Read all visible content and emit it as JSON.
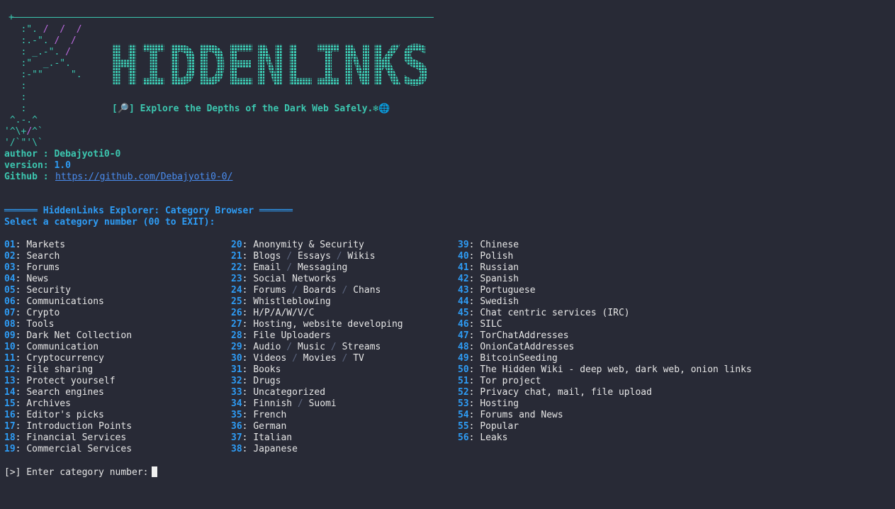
{
  "logo": {
    "text": "HIDDENLINKS"
  },
  "tagline": "[🔎] Explore the Depths of the Dark Web Safely.❄🌐",
  "meta": {
    "author_label": "author : ",
    "author": "Debajyoti0-0",
    "version_label": "version: ",
    "version": "1.0",
    "github_label": "Github : ",
    "github": "https://github.com/Debajyoti0-0/"
  },
  "header": {
    "rule": "══════",
    "title": "HiddenLinks Explorer: Category Browser",
    "prompt": "Select a category number (00 to EXIT):"
  },
  "categories": [
    [
      "01",
      "Markets"
    ],
    [
      "02",
      "Search"
    ],
    [
      "03",
      "Forums"
    ],
    [
      "04",
      "News"
    ],
    [
      "05",
      "Security"
    ],
    [
      "06",
      "Communications"
    ],
    [
      "07",
      "Crypto"
    ],
    [
      "08",
      "Tools"
    ],
    [
      "09",
      "Dark Net Collection"
    ],
    [
      "10",
      "Communication"
    ],
    [
      "11",
      "Cryptocurrency"
    ],
    [
      "12",
      "File sharing"
    ],
    [
      "13",
      "Protect yourself"
    ],
    [
      "14",
      "Search engines"
    ],
    [
      "15",
      "Archives"
    ],
    [
      "16",
      "Editor's picks"
    ],
    [
      "17",
      "Introduction Points"
    ],
    [
      "18",
      "Financial Services"
    ],
    [
      "19",
      "Commercial Services"
    ],
    [
      "20",
      "Anonymity & Security"
    ],
    [
      "21",
      "Blogs / Essays / Wikis"
    ],
    [
      "22",
      "Email / Messaging"
    ],
    [
      "23",
      "Social Networks"
    ],
    [
      "24",
      "Forums / Boards / Chans"
    ],
    [
      "25",
      "Whistleblowing"
    ],
    [
      "26",
      "H/P/A/W/V/C"
    ],
    [
      "27",
      "Hosting, website developing"
    ],
    [
      "28",
      "File Uploaders"
    ],
    [
      "29",
      "Audio / Music / Streams"
    ],
    [
      "30",
      "Videos / Movies / TV"
    ],
    [
      "31",
      "Books"
    ],
    [
      "32",
      "Drugs"
    ],
    [
      "33",
      "Uncategorized"
    ],
    [
      "34",
      "Finnish / Suomi"
    ],
    [
      "35",
      "French"
    ],
    [
      "36",
      "German"
    ],
    [
      "37",
      "Italian"
    ],
    [
      "38",
      "Japanese"
    ],
    [
      "39",
      "Chinese"
    ],
    [
      "40",
      "Polish"
    ],
    [
      "41",
      "Russian"
    ],
    [
      "42",
      "Spanish"
    ],
    [
      "43",
      "Portuguese"
    ],
    [
      "44",
      "Swedish"
    ],
    [
      "45",
      "Chat centric services (IRC)"
    ],
    [
      "46",
      "SILC"
    ],
    [
      "47",
      "TorChatAddresses"
    ],
    [
      "48",
      "OnionCatAddresses"
    ],
    [
      "49",
      "BitcoinSeeding"
    ],
    [
      "50",
      "The Hidden Wiki - deep web, dark web, onion links"
    ],
    [
      "51",
      "Tor project"
    ],
    [
      "52",
      "Privacy chat, mail, file upload"
    ],
    [
      "53",
      "Hosting"
    ],
    [
      "54",
      "Forums and News"
    ],
    [
      "55",
      "Popular"
    ],
    [
      "56",
      "Leaks"
    ]
  ],
  "input": {
    "prompt": "[>] Enter category number:",
    "value": ""
  },
  "colors": {
    "background": "#282a36",
    "teal": "#3cc7b0",
    "blue": "#2e9cf5",
    "purple": "#bd6be0",
    "link": "#4a8df0"
  }
}
